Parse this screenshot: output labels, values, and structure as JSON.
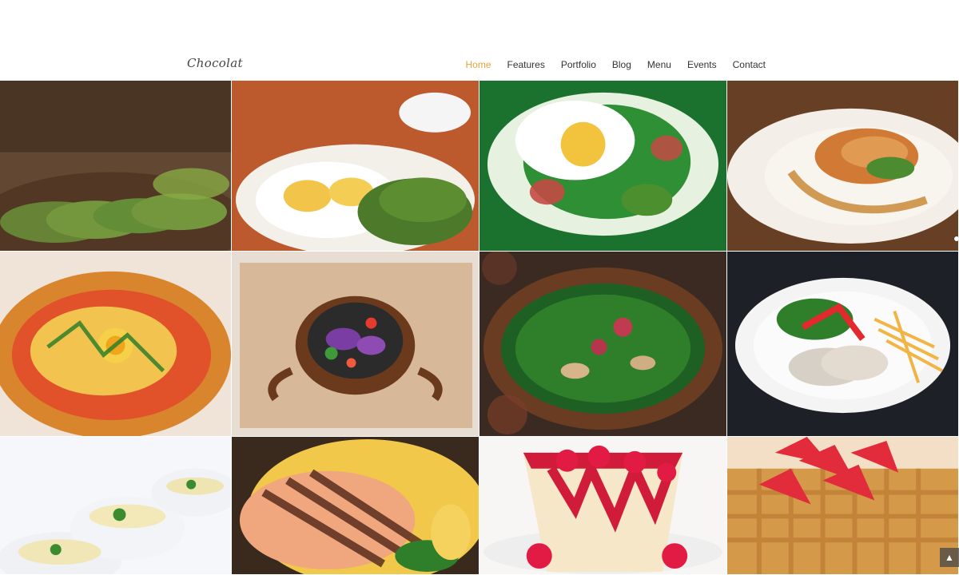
{
  "header": {
    "logo": "Chocolat",
    "nav": [
      {
        "label": "Home"
      },
      {
        "label": "Features"
      },
      {
        "label": "Portfolio"
      },
      {
        "label": "Blog"
      },
      {
        "label": "Menu"
      },
      {
        "label": "Events"
      },
      {
        "label": "Contact"
      }
    ],
    "active_label": "Home"
  },
  "gallery": {
    "items": [
      {
        "name": "avocado-toast"
      },
      {
        "name": "eggs-and-avocado"
      },
      {
        "name": "poached-egg-salad"
      },
      {
        "name": "seared-fish-plate"
      },
      {
        "name": "baked-egg-dish"
      },
      {
        "name": "salad-bowl-board"
      },
      {
        "name": "spinach-salad-bowl"
      },
      {
        "name": "chicken-and-fries"
      },
      {
        "name": "creamy-soup-cups"
      },
      {
        "name": "grilled-salmon"
      },
      {
        "name": "raspberry-cheesecake"
      },
      {
        "name": "strawberry-waffle"
      }
    ]
  },
  "colors": {
    "accent": "#e7a23b",
    "nav_text": "#333333",
    "background": "#ffffff"
  },
  "icons": {
    "scroll_top": "chevron-up-icon",
    "slider_dot": "dot-icon"
  }
}
